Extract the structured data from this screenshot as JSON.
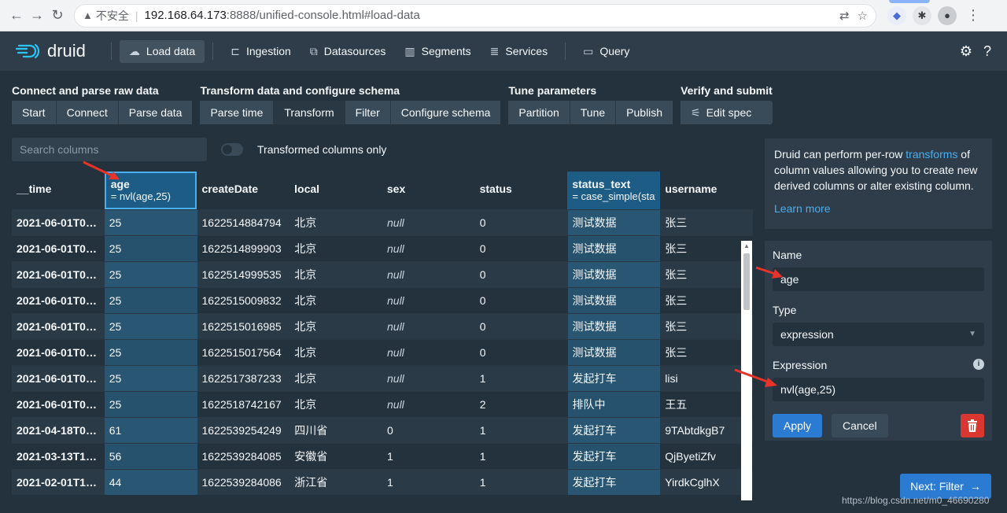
{
  "browser": {
    "insecure_label": "不安全",
    "host": "192.168.64.173",
    "path": ":8888/unified-console.html#load-data"
  },
  "app": {
    "brand": "druid",
    "nav": [
      {
        "label": "Load data",
        "icon": "cloud-upload-icon",
        "active": true
      },
      {
        "label": "Ingestion",
        "icon": "gantt-icon"
      },
      {
        "label": "Datasources",
        "icon": "datasource-icon"
      },
      {
        "label": "Segments",
        "icon": "segments-icon"
      },
      {
        "label": "Services",
        "icon": "database-icon"
      },
      {
        "label": "Query",
        "icon": "console-icon"
      }
    ]
  },
  "workflow": [
    {
      "title": "Connect and parse raw data",
      "steps": [
        "Start",
        "Connect",
        "Parse data"
      ]
    },
    {
      "title": "Transform data and configure schema",
      "steps": [
        "Parse time",
        "Transform",
        "Filter",
        "Configure schema"
      ],
      "active": "Transform"
    },
    {
      "title": "Tune parameters",
      "steps": [
        "Partition",
        "Tune",
        "Publish"
      ]
    },
    {
      "title": "Verify and submit",
      "steps": [
        "Edit spec"
      ]
    }
  ],
  "search": {
    "placeholder": "Search columns",
    "toggle_label": "Transformed columns only"
  },
  "table": {
    "columns": [
      {
        "name": "__time",
        "sub": ""
      },
      {
        "name": "age",
        "sub": "= nvl(age,25)"
      },
      {
        "name": "createDate",
        "sub": ""
      },
      {
        "name": "local",
        "sub": ""
      },
      {
        "name": "sex",
        "sub": ""
      },
      {
        "name": "status",
        "sub": ""
      },
      {
        "name": "status_text",
        "sub": "= case_simple(stat"
      },
      {
        "name": "username",
        "sub": ""
      }
    ],
    "rows": [
      [
        "2021-06-01T02:...",
        "25",
        "1622514884794",
        "北京",
        "null",
        "0",
        "测试数据",
        "张三"
      ],
      [
        "2021-06-01T02:...",
        "25",
        "1622514899903",
        "北京",
        "null",
        "0",
        "测试数据",
        "张三"
      ],
      [
        "2021-06-01T02:...",
        "25",
        "1622514999535",
        "北京",
        "null",
        "0",
        "测试数据",
        "张三"
      ],
      [
        "2021-06-01T02:...",
        "25",
        "1622515009832",
        "北京",
        "null",
        "0",
        "测试数据",
        "张三"
      ],
      [
        "2021-06-01T02:...",
        "25",
        "1622515016985",
        "北京",
        "null",
        "0",
        "测试数据",
        "张三"
      ],
      [
        "2021-06-01T02:...",
        "25",
        "1622515017564",
        "北京",
        "null",
        "0",
        "测试数据",
        "张三"
      ],
      [
        "2021-06-01T03:...",
        "25",
        "1622517387233",
        "北京",
        "null",
        "1",
        "发起打车",
        "lisi"
      ],
      [
        "2021-06-01T03:...",
        "25",
        "1622518742167",
        "北京",
        "null",
        "2",
        "排队中",
        "王五"
      ],
      [
        "2021-04-18T00:...",
        "61",
        "1622539254249",
        "四川省",
        "0",
        "1",
        "发起打车",
        "9TAbtdkgB7"
      ],
      [
        "2021-03-13T10:...",
        "56",
        "1622539284085",
        "安徽省",
        "1",
        "1",
        "发起打车",
        "QjByetiZfv"
      ],
      [
        "2021-02-01T16:...",
        "44",
        "1622539284086",
        "浙江省",
        "1",
        "1",
        "发起打车",
        "YirdkCglhX"
      ]
    ]
  },
  "info": {
    "text_before": "Druid can perform per-row ",
    "link": "transforms",
    "text_after": " of column values allowing you to create new derived columns or alter existing column.",
    "learn_more": "Learn more"
  },
  "editor": {
    "name_label": "Name",
    "name_value": "age",
    "type_label": "Type",
    "type_value": "expression",
    "expression_label": "Expression",
    "expression_value": "nvl(age,25)",
    "apply": "Apply",
    "cancel": "Cancel"
  },
  "next_button": "Next: Filter",
  "watermark": "https://blog.csdn.net/m0_46690280",
  "colors": {
    "app_bg": "#24323e",
    "nav_bg": "#2f3d4a",
    "accent_blue": "#2b7bd2",
    "highlight_column": "#1d5d85",
    "danger": "#d9372f",
    "annotation_arrow": "#e8332a"
  }
}
